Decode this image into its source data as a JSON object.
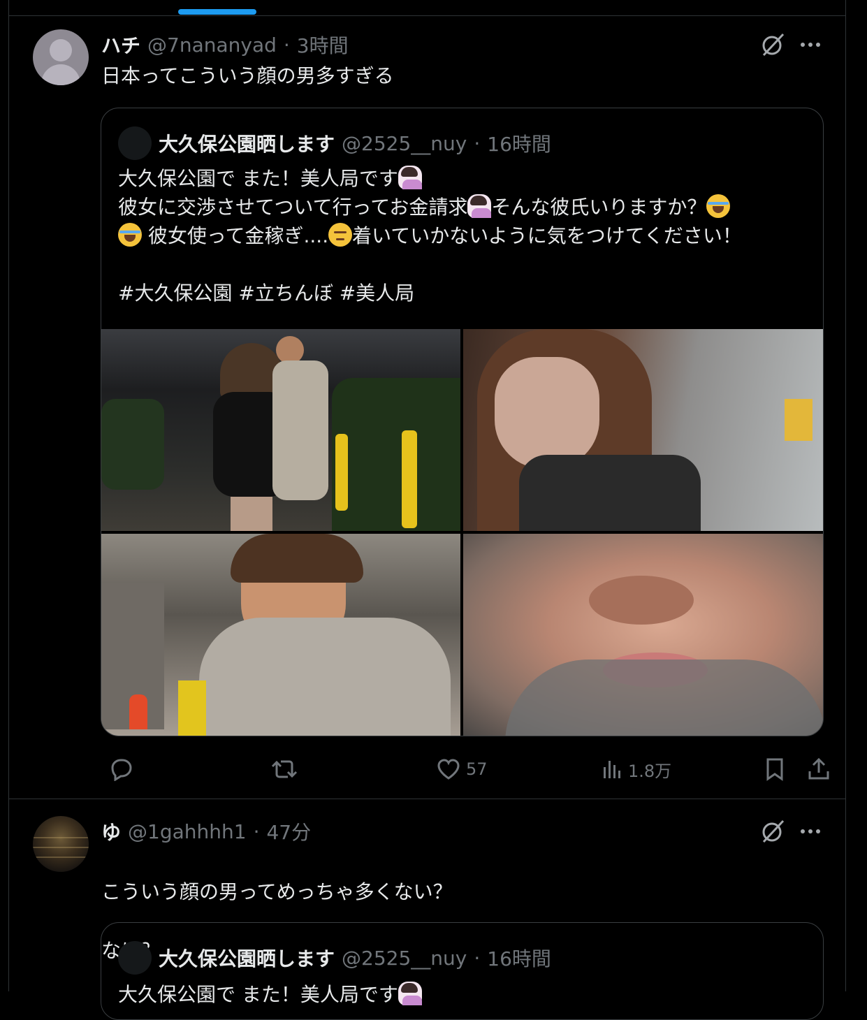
{
  "post1": {
    "author_name": "ハチ",
    "handle": "@7nananyad",
    "time": "3時間",
    "separator": "·",
    "text": "日本ってこういう顔の男多すぎる",
    "quote": {
      "author_name": "大久保公園晒します",
      "handle": "@2525__nuy",
      "time": "16時間",
      "lines": [
        "大久保公園で また！美人局です",
        "彼女に交渉させてついて行ってお金請求",
        "そんな彼氏いりますか？",
        "彼女使って金稼ぎ....",
        "着いていかないように気をつけてください！",
        "#大久保公園 #立ちんぼ #美人局"
      ],
      "emoji": [
        "woman-tipping-hand",
        "loudly-crying-face",
        "pensive-face"
      ],
      "images": [
        "street-night-couple-photo",
        "woman-face-closeup-photo",
        "man-puffer-jacket-photo",
        "man-face-closeup-photo"
      ]
    },
    "actions": {
      "reply_count": "",
      "repost_count": "",
      "like_count": "57",
      "view_count": "1.8万"
    }
  },
  "post2": {
    "author_name": "ゆ",
    "handle": "@1gahhhh1",
    "time": "47分",
    "separator": "·",
    "text_lines": [
      "こういう顔の男ってめっちゃ多くない？",
      "なに？"
    ],
    "quote": {
      "author_name": "大久保公園晒します",
      "handle": "@2525__nuy",
      "time": "16時間",
      "first_line": "大久保公園で また！美人局です"
    }
  },
  "colors": {
    "background": "#000000",
    "text": "#e7e9ea",
    "muted": "#71767b",
    "border": "#2f3336",
    "accent": "#1d9bf0"
  },
  "icons": [
    "grok-icon",
    "more-icon",
    "reply-icon",
    "repost-icon",
    "like-icon",
    "views-icon",
    "bookmark-icon",
    "share-icon"
  ]
}
